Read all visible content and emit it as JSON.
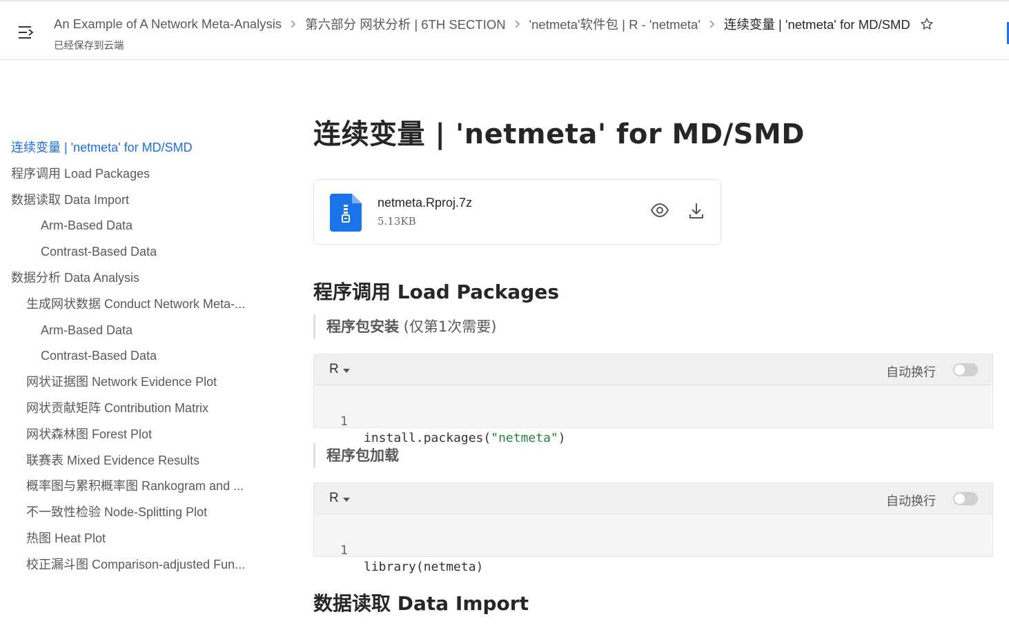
{
  "header": {
    "breadcrumbs": [
      "An Example of A Network Meta-Analysis",
      "第六部分 网状分析 | 6TH SECTION",
      "'netmeta'软件包 | R - 'netmeta'",
      "连续变量 | 'netmeta' for MD/SMD"
    ],
    "saved_status": "已经保存到云端"
  },
  "toc": {
    "items": [
      {
        "label": "连续变量 | 'netmeta' for MD/SMD",
        "level": 1,
        "active": true
      },
      {
        "label": "程序调用 Load Packages",
        "level": 1
      },
      {
        "label": "数据读取 Data Import",
        "level": 1
      },
      {
        "label": "Arm-Based Data",
        "level": 3
      },
      {
        "label": "Contrast-Based Data",
        "level": 3
      },
      {
        "label": "数据分析 Data Analysis",
        "level": 1
      },
      {
        "label": "生成网状数据 Conduct Network Meta-...",
        "level": 2
      },
      {
        "label": "Arm-Based Data",
        "level": 3
      },
      {
        "label": "Contrast-Based Data",
        "level": 3
      },
      {
        "label": "网状证据图 Network Evidence Plot",
        "level": 2
      },
      {
        "label": "网状贡献矩阵 Contribution Matrix",
        "level": 2
      },
      {
        "label": "网状森林图 Forest Plot",
        "level": 2
      },
      {
        "label": "联赛表 Mixed Evidence Results",
        "level": 2
      },
      {
        "label": "概率图与累积概率图 Rankogram and ...",
        "level": 2
      },
      {
        "label": "不一致性检验 Node-Splitting Plot",
        "level": 2
      },
      {
        "label": "热图 Heat Plot",
        "level": 2
      },
      {
        "label": "校正漏斗图 Comparison-adjusted Fun...",
        "level": 2
      }
    ]
  },
  "main": {
    "title": "连续变量 | 'netmeta' for MD/SMD",
    "attachment": {
      "name": "netmeta.Rproj.7z",
      "size": "5.13KB"
    },
    "section1": {
      "heading": "程序调用 Load Packages",
      "quote1": {
        "bold": "程序包安装",
        "rest": " (仅第1次需要)"
      },
      "code1": {
        "lang": "R",
        "wrap_label": "自动换行",
        "line_no": "1",
        "code_prefix": "install.packages(",
        "code_string": "\"netmeta\"",
        "code_suffix": ")"
      },
      "quote2": {
        "bold": "程序包加载"
      },
      "code2": {
        "lang": "R",
        "wrap_label": "自动换行",
        "line_no": "1",
        "code": "library(netmeta)"
      }
    },
    "section2": {
      "heading": "数据读取 Data Import"
    }
  },
  "colors": {
    "accent": "#1a6ee0",
    "file_icon": "#1a73e8",
    "code_string": "#22863a"
  }
}
